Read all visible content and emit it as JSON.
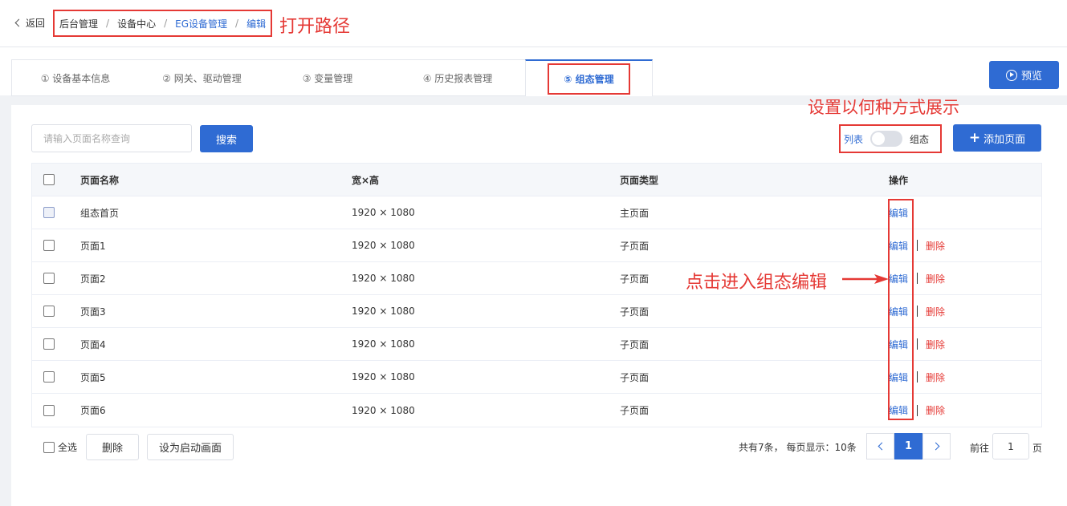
{
  "header": {
    "back_label": "返回",
    "breadcrumb": [
      "后台管理",
      "设备中心",
      "EG设备管理",
      "编辑"
    ],
    "breadcrumb_sep": "/"
  },
  "annotations": {
    "open_path": "打开路径",
    "display_mode": "设置以何种方式展示",
    "click_edit": "点击进入组态编辑"
  },
  "tabs": [
    {
      "label": "① 设备基本信息",
      "active": false
    },
    {
      "label": "② 网关、驱动管理",
      "active": false
    },
    {
      "label": "③ 变量管理",
      "active": false
    },
    {
      "label": "④ 历史报表管理",
      "active": false
    },
    {
      "label": "⑤ 组态管理",
      "active": true
    }
  ],
  "preview_label": "预览",
  "toolbar": {
    "search_placeholder": "请输入页面名称查询",
    "search_label": "搜索",
    "toggle_left": "列表",
    "toggle_right": "组态",
    "add_label": "添加页面"
  },
  "table": {
    "headers": {
      "name": "页面名称",
      "size": "宽×高",
      "type": "页面类型",
      "ops": "操作"
    },
    "edit_label": "编辑",
    "delete_label": "删除",
    "rows": [
      {
        "name": "组态首页",
        "size": "1920 × 1080",
        "type": "主页面",
        "deletable": false
      },
      {
        "name": "页面1",
        "size": "1920 × 1080",
        "type": "子页面",
        "deletable": true
      },
      {
        "name": "页面2",
        "size": "1920 × 1080",
        "type": "子页面",
        "deletable": true
      },
      {
        "name": "页面3",
        "size": "1920 × 1080",
        "type": "子页面",
        "deletable": true
      },
      {
        "name": "页面4",
        "size": "1920 × 1080",
        "type": "子页面",
        "deletable": true
      },
      {
        "name": "页面5",
        "size": "1920 × 1080",
        "type": "子页面",
        "deletable": true
      },
      {
        "name": "页面6",
        "size": "1920 × 1080",
        "type": "子页面",
        "deletable": true
      }
    ]
  },
  "footer": {
    "select_all": "全选",
    "delete_label": "删除",
    "set_start_label": "设为启动画面",
    "total_text": "共有7条， 每页显示：10条",
    "current_page": "1",
    "goto_label": "前往",
    "goto_value": "1",
    "goto_suffix": "页"
  },
  "colors": {
    "primary": "#2f6bd3",
    "annotation": "#e53935",
    "danger": "#e53935"
  }
}
